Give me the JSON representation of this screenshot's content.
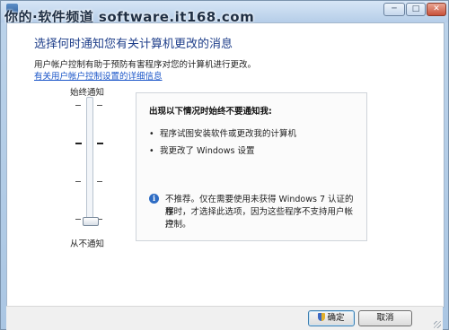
{
  "window": {
    "watermark": "你的·软件频道 software.it168.com",
    "controls": {
      "minimize": "─",
      "maximize": "□",
      "close": "✕"
    }
  },
  "main": {
    "heading": "选择何时通知您有关计算机更改的消息",
    "description": "用户帐户控制有助于预防有害程序对您的计算机进行更改。",
    "link": "有关用户帐户控制设置的详细信息"
  },
  "slider": {
    "label_top": "始终通知",
    "label_bottom": "从不通知",
    "level_of_4": 0
  },
  "panel": {
    "title": "出现以下情况时始终不要通知我:",
    "bullets": [
      "程序试图安装软件或更改我的计算机",
      "我更改了 Windows 设置"
    ],
    "note_lines": [
      "不推荐。仅在需要使用未获得 Windows 7 认证的程",
      "序时，才选择此选项，因为这些程序不支持用户帐户",
      "控制。"
    ]
  },
  "footer": {
    "ok_label": "确定",
    "cancel_label": "取消"
  },
  "icons": {
    "info": "info-icon",
    "shield": "shield-icon"
  }
}
